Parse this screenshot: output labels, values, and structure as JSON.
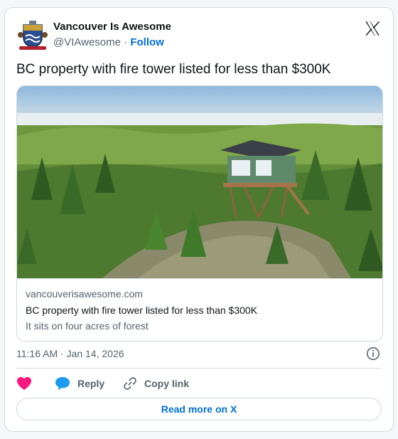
{
  "colors": {
    "link_blue": "#006fd6",
    "muted_text": "#536471",
    "border": "#cfd9de",
    "heart": "#f91880",
    "reply_bubble": "#1d9bf0"
  },
  "author": {
    "name": "Vancouver Is Awesome",
    "handle": "@VIAwesome",
    "separator": "·",
    "follow_label": "Follow",
    "avatar_icon": "city-crest-logo"
  },
  "tweet": {
    "text": "BC property with fire tower listed for less than $300K"
  },
  "card": {
    "image_icon": "forest-fire-tower-photo",
    "domain": "vancouverisawesome.com",
    "title": "BC property with fire tower listed for less than $300K",
    "description": "It sits on four acres of forest"
  },
  "meta": {
    "timestamp": "11:16 AM · Jan 14, 2026",
    "info_icon": "info-icon"
  },
  "actions": {
    "like_icon": "heart-icon",
    "reply_label": "Reply",
    "copy_label": "Copy link"
  },
  "footer": {
    "read_more_label": "Read more on X"
  }
}
